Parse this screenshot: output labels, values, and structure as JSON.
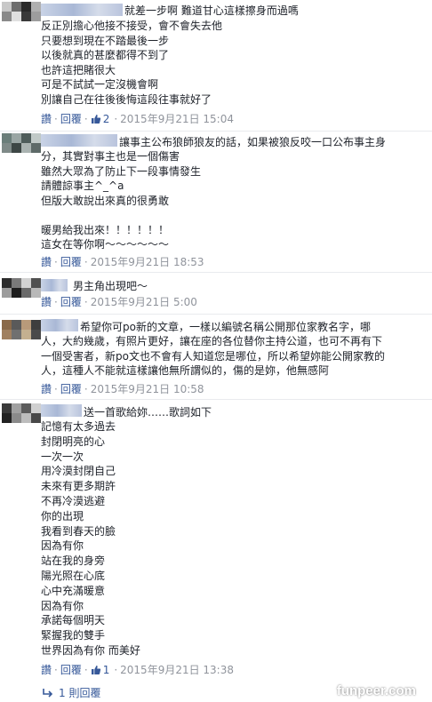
{
  "comments": [
    {
      "first_line": "就差一步啊 難道甘心這樣擦身而過嗎",
      "lines": [
        "反正別擔心他接不接受，會不會失去他",
        "只要想到現在不踏最後一步",
        "以後就真的甚麼都得不到了",
        "也許這把賭很大",
        "可是不試試一定沒機會啊",
        "別讓自己在往後後悔這段往事就好了"
      ],
      "actions": {
        "like": "讚",
        "reply": "回覆",
        "likes": "2",
        "timestamp": "2015年9月21日 15:04"
      }
    },
    {
      "first_line": "讓事主公布狼師狼友的話，如果被狼反咬一口公布事主身",
      "lines": [
        "分，其實對事主也是一個傷害",
        "雖然大眾為了防止下一段事情發生",
        "請體諒事主^_^a",
        "但版大敢說出來真的很勇敢",
        "",
        "暖男給我出來！！！！！！",
        "這女在等你啊～～～～～～"
      ],
      "actions": {
        "like": "讚",
        "reply": "回覆",
        "likes": "",
        "timestamp": "2015年9月21日 18:53"
      }
    },
    {
      "first_line": "男主角出現吧～",
      "lines": [],
      "actions": {
        "like": "讚",
        "reply": "回覆",
        "likes": "",
        "timestamp": "2015年9月21日 5:00"
      }
    },
    {
      "first_line": "希望你可po新的文章，一樣以編號名稱公開那位家教名字，哪",
      "lines": [
        "人，大約幾歲，有照片更好，讓在座的各位替你主持公道，也可不再有下",
        "一個受害者，新po文也不會有人知道您是哪位，所以希望妳能公開家教的",
        "人，這種人不能就這樣讓他無所謂似的，傷的是妳，他無感阿"
      ],
      "actions": {
        "like": "讚",
        "reply": "回覆",
        "likes": "",
        "timestamp": "2015年9月21日 10:58"
      }
    },
    {
      "first_line": "送一首歌給妳……歌詞如下",
      "lines": [
        "記憶有太多過去",
        "封閉明亮的心",
        "一次一次",
        "用冷漠封閉自己",
        "未來有更多期許",
        "不再冷漠逃避",
        "你的出現",
        "我看到春天的臉",
        "因為有你",
        "站在我的身旁",
        "陽光照在心底",
        "心中充滿暖意",
        "因為有你",
        "承諾每個明天",
        "緊握我的雙手",
        "世界因為有你 而美好"
      ],
      "actions": {
        "like": "讚",
        "reply": "回覆",
        "likes": "1",
        "timestamp": "2015年9月21日 13:38"
      }
    }
  ],
  "replies_link": "1 則回覆",
  "watermark": "funpeer.com",
  "colors": {
    "link": "#365899",
    "meta": "#90949c",
    "text": "#1d2129"
  }
}
